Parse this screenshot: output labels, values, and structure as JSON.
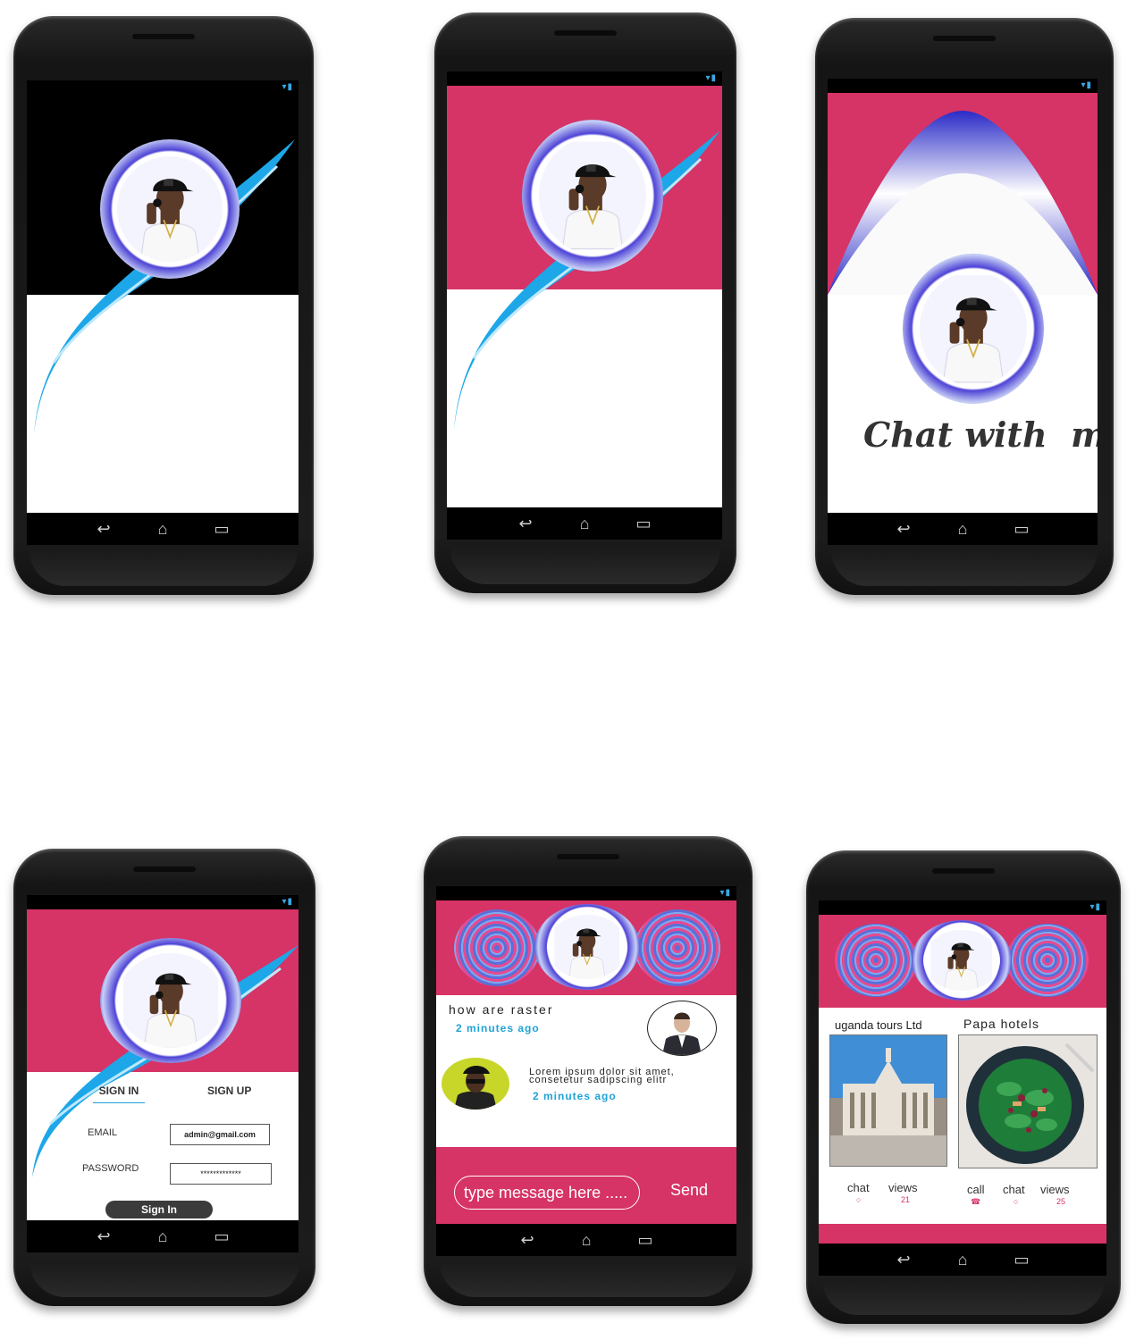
{
  "status_icons": "▾▮",
  "nav": {
    "back": "↩",
    "home": "⌂",
    "recent": "▭"
  },
  "splash3": {
    "tagline": "Chat with  me"
  },
  "signin": {
    "tab_signin": "SIGN IN",
    "tab_signup": "SIGN UP",
    "email_label": "EMAIL",
    "email_value": "admin@gmail.com",
    "password_label": "PASSWORD",
    "password_value": "*************",
    "button": "Sign In"
  },
  "chat": {
    "messages": [
      {
        "text": "how are raster",
        "time": "2 minutes ago"
      },
      {
        "text": "Lorem ipsum dolor sit amet, consetetur sadipscing elitr",
        "time": "2 minutes ago"
      }
    ],
    "input_placeholder": "type  message here .....",
    "send_label": "Send"
  },
  "listing": {
    "cards": [
      {
        "title": "uganda tours Ltd",
        "actions": [
          "chat",
          "views"
        ],
        "views": "21"
      },
      {
        "title": "Papa hotels",
        "actions": [
          "call",
          "chat",
          "views"
        ],
        "views": "25"
      }
    ]
  },
  "colors": {
    "accent": "#d63366",
    "ring": "#2a2bc7",
    "swoosh": "#1da7e8",
    "time": "#1fa3d6"
  }
}
